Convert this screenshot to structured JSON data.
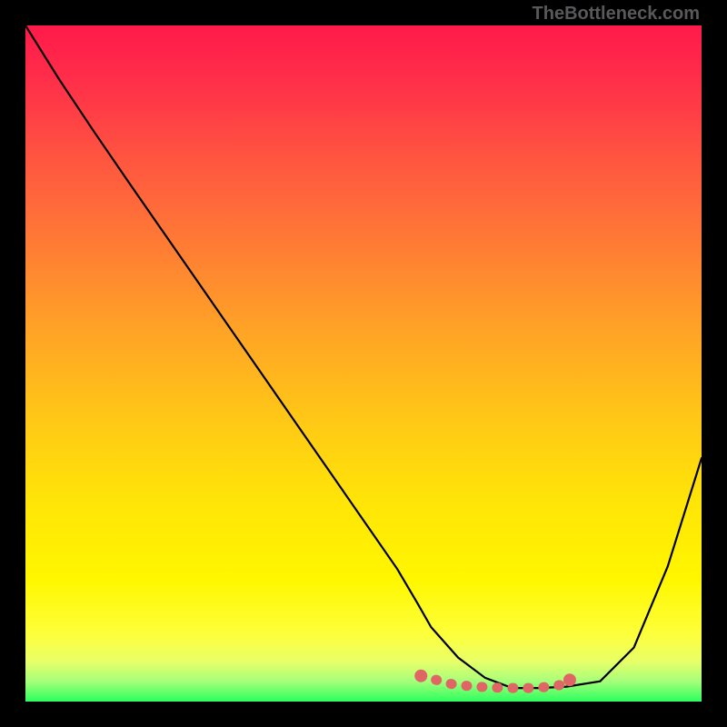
{
  "watermark": "TheBottleneck.com",
  "chart_data": {
    "type": "line",
    "title": "",
    "xlabel": "",
    "ylabel": "",
    "xlim": [
      0,
      100
    ],
    "ylim": [
      0,
      100
    ],
    "series": [
      {
        "name": "black-curve",
        "x": [
          0,
          5,
          10,
          15,
          20,
          25,
          30,
          35,
          40,
          45,
          50,
          55,
          58,
          60,
          64,
          68,
          72,
          76,
          80,
          85,
          90,
          95,
          100
        ],
        "values": [
          100,
          92,
          84.5,
          77.2,
          70,
          62.8,
          55.6,
          48.4,
          41.2,
          34,
          26.8,
          19.6,
          14.5,
          11,
          6.5,
          3.5,
          2,
          2,
          2.2,
          3,
          8,
          20,
          36
        ]
      },
      {
        "name": "pink-dots",
        "x": [
          58.5,
          63,
          65.5,
          68.5,
          71.5,
          74.5,
          76.5,
          79.5,
          80.5
        ],
        "values": [
          3.8,
          2.6,
          2.3,
          2.1,
          2.0,
          2.0,
          2.1,
          2.5,
          3.2
        ]
      }
    ],
    "colors": {
      "curve": "#000000",
      "dots": "#e06666",
      "gradient_top": "#ff1a4a",
      "gradient_bottom": "#2bff5e"
    }
  }
}
